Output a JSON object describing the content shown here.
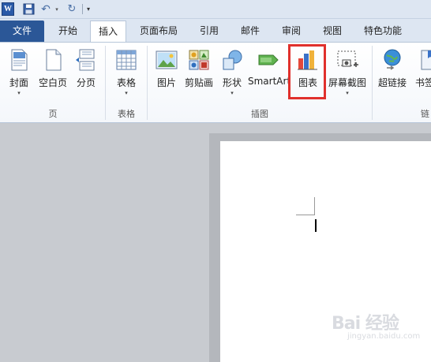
{
  "quick_access": {
    "app_logo": "W",
    "icons": [
      "word-logo",
      "save-icon",
      "undo-icon",
      "redo-icon",
      "customize-icon"
    ]
  },
  "tabs": [
    {
      "label": "文件",
      "name": "tab-file"
    },
    {
      "label": "开始",
      "name": "tab-home"
    },
    {
      "label": "插入",
      "name": "tab-insert",
      "active": true
    },
    {
      "label": "页面布局",
      "name": "tab-page-layout"
    },
    {
      "label": "引用",
      "name": "tab-references"
    },
    {
      "label": "邮件",
      "name": "tab-mailings"
    },
    {
      "label": "审阅",
      "name": "tab-review"
    },
    {
      "label": "视图",
      "name": "tab-view"
    },
    {
      "label": "特色功能",
      "name": "tab-special-features"
    }
  ],
  "ribbon": {
    "groups": {
      "pages": "页",
      "tables": "表格",
      "illustrations": "插图",
      "links": "链"
    },
    "buttons": {
      "cover": "封面",
      "blank_page": "空白页",
      "page_break": "分页",
      "table": "表格",
      "picture": "图片",
      "clipart": "剪贴画",
      "shapes": "形状",
      "smartart": "SmartArt",
      "chart": "图表",
      "screenshot": "屏幕截图",
      "hyperlink": "超链接",
      "bookmark": "书签"
    }
  },
  "colors": {
    "file_tab": "#2b5797",
    "highlight": "#e0302c",
    "ribbon_bg": "#ffffff",
    "doc_bg": "#c8cbd0"
  },
  "watermark": {
    "main": "Bai 经验",
    "sub": "jingyan.baidu.com"
  }
}
